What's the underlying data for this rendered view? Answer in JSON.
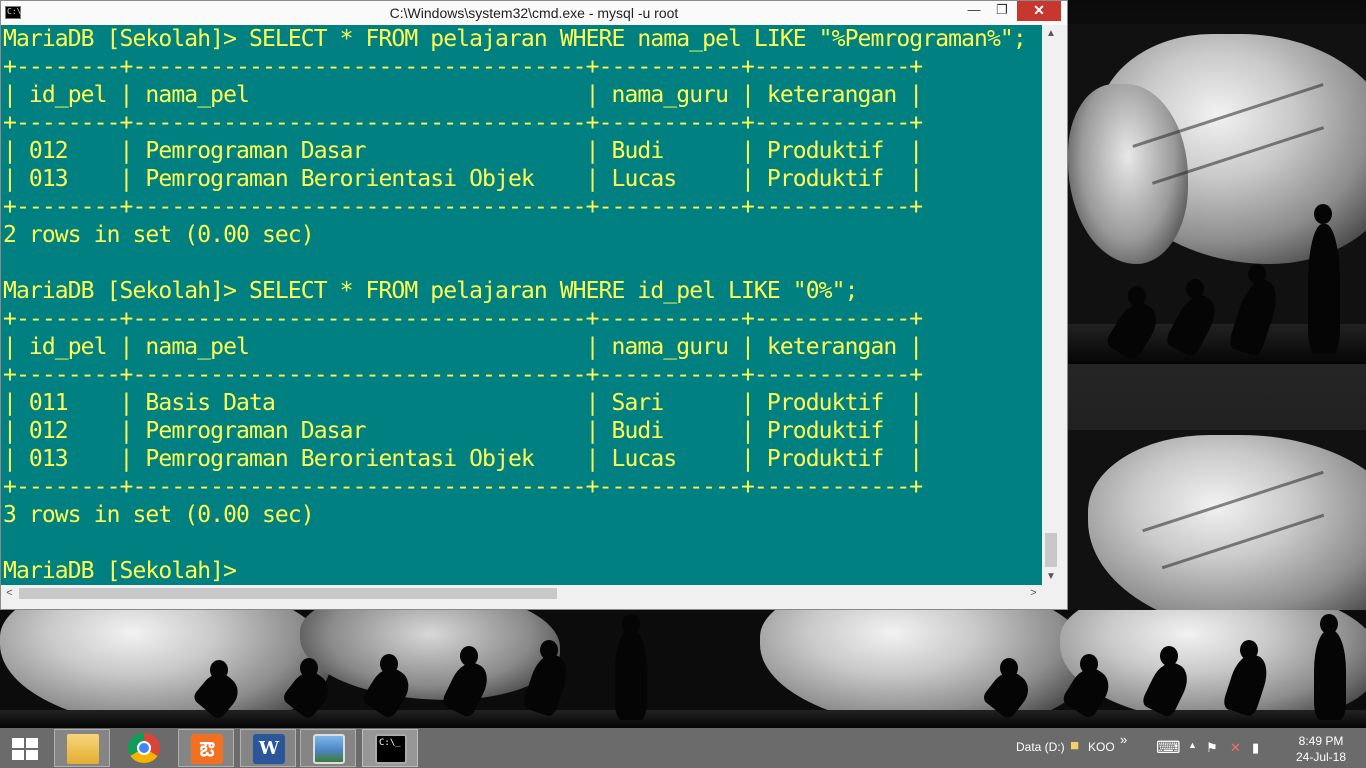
{
  "window": {
    "title": "C:\\Windows\\system32\\cmd.exe - mysql  -u root",
    "icon_label": "C:\\",
    "minimize_glyph": "—",
    "maximize_glyph": "❐",
    "close_glyph": "✕"
  },
  "console": {
    "lines": [
      "MariaDB [Sekolah]> SELECT * FROM pelajaran WHERE nama_pel LIKE \"%Pemrograman%\";",
      "+--------+-----------------------------------+-----------+------------+",
      "| id_pel | nama_pel                          | nama_guru | keterangan |",
      "+--------+-----------------------------------+-----------+------------+",
      "| 012    | Pemrograman Dasar                 | Budi      | Produktif  |",
      "| 013    | Pemrograman Berorientasi Objek    | Lucas     | Produktif  |",
      "+--------+-----------------------------------+-----------+------------+",
      "2 rows in set (0.00 sec)",
      "",
      "MariaDB [Sekolah]> SELECT * FROM pelajaran WHERE id_pel LIKE \"0%\";",
      "+--------+-----------------------------------+-----------+------------+",
      "| id_pel | nama_pel                          | nama_guru | keterangan |",
      "+--------+-----------------------------------+-----------+------------+",
      "| 011    | Basis Data                        | Sari      | Produktif  |",
      "| 012    | Pemrograman Dasar                 | Budi      | Produktif  |",
      "| 013    | Pemrograman Berorientasi Objek    | Lucas     | Produktif  |",
      "+--------+-----------------------------------+-----------+------------+",
      "3 rows in set (0.00 sec)",
      "",
      "MariaDB [Sekolah]>"
    ]
  },
  "scrollbars": {
    "up_glyph": "▲",
    "down_glyph": "▼",
    "left_glyph": "<",
    "right_glyph": ">"
  },
  "taskbar": {
    "apps": [
      {
        "name": "file-explorer",
        "icon": "folder-icon"
      },
      {
        "name": "google-chrome",
        "icon": "chrome-icon"
      },
      {
        "name": "xampp",
        "icon": "xampp-icon",
        "glyph": "ఔ"
      },
      {
        "name": "microsoft-word",
        "icon": "word-icon",
        "glyph": "W"
      },
      {
        "name": "photo-viewer",
        "icon": "photo-icon"
      },
      {
        "name": "command-prompt",
        "icon": "cmd-icon",
        "glyph": "C:\\_"
      }
    ],
    "tray": {
      "drive_label": "Data (D:)",
      "folder_label": "KOO",
      "expand_glyph": "»",
      "time": "8:49 PM",
      "date": "24-Jul-18"
    }
  },
  "colors": {
    "console_bg": "#008080",
    "console_text": "#ffff55",
    "close_button": "#c7372f",
    "taskbar_bg": "#6b6b6b"
  }
}
